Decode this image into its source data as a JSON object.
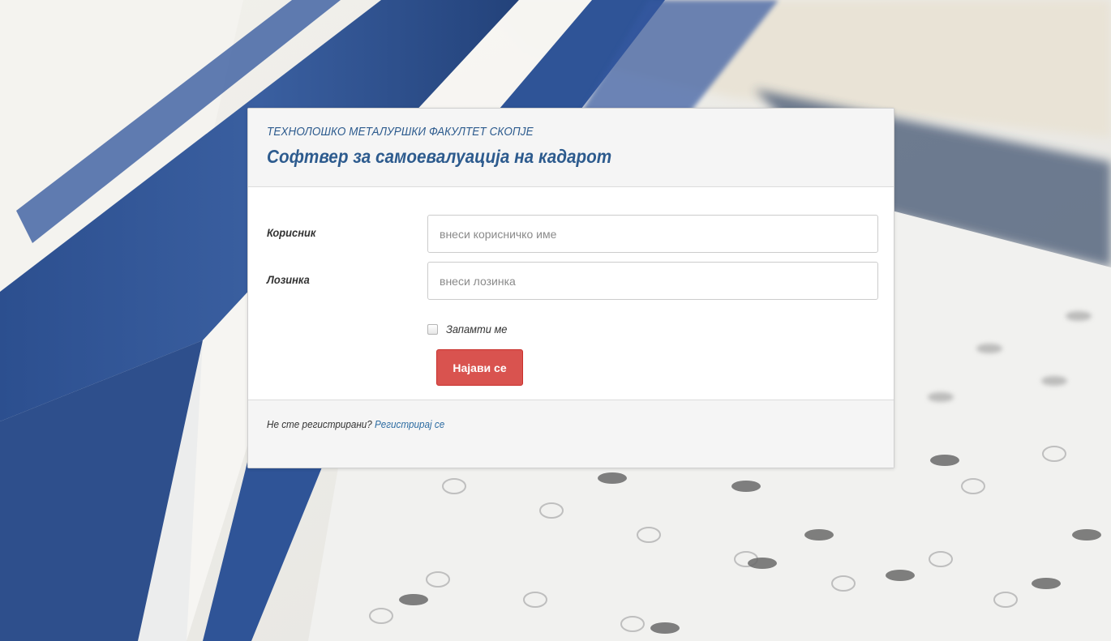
{
  "header": {
    "faculty_name": "ТЕХНОЛОШКО МЕТАЛУРШКИ ФАКУЛТЕТ СКОПЈЕ",
    "app_title": "Софтвер за самоевалуација на кадарот"
  },
  "form": {
    "username_label": "Корисник",
    "username_placeholder": "внеси корисничко име",
    "username_value": "",
    "password_label": "Лозинка",
    "password_placeholder": "внеси лозинка",
    "password_value": "",
    "remember_label": "Запамти ме",
    "remember_checked": false,
    "login_label": "Најави се"
  },
  "footer": {
    "question": "Не сте регистрирани?",
    "register_link": "Регистрирај се"
  },
  "colors": {
    "title": "#2d5b8e",
    "button": "#d9534f",
    "link": "#2d6ca2",
    "panel_bg": "#f5f5f5"
  },
  "background": {
    "description_icon": "answer-sheet-background"
  }
}
